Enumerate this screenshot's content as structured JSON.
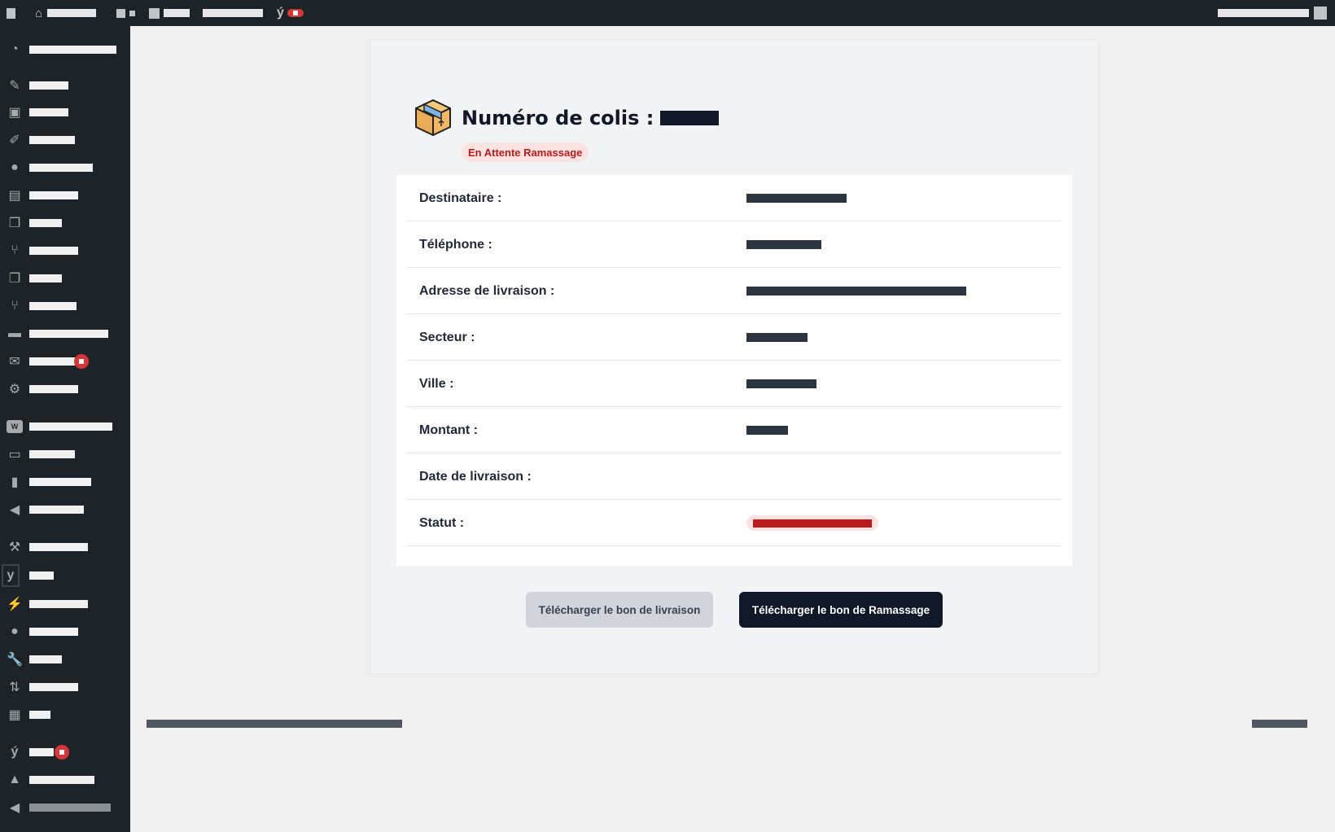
{
  "admin_bar": {
    "items": [
      "wp-logo-icon",
      "home-icon",
      "updates-icon",
      "comments-icon",
      "new-icon",
      "yoast-icon"
    ],
    "badge_color": "#d63638"
  },
  "sidebar": {
    "background": "#1d2327",
    "icons": [
      "dashboard-icon",
      "pin-icon",
      "media-icon",
      "brush-icon",
      "user-icon",
      "page-edit-icon",
      "pages-icon",
      "tree-icon",
      "pages-icon",
      "tree-icon",
      "comment-icon",
      "mail-icon",
      "settings-icon",
      "woo-icon",
      "archive-icon",
      "chart-icon",
      "megaphone-icon",
      "hammer-icon",
      "yoast-icon",
      "plugin-icon",
      "user-icon",
      "wrench-icon",
      "import-icon",
      "table-icon",
      "yoast-icon",
      "graduation-cap-icon",
      "collapse-icon"
    ]
  },
  "parcel": {
    "title": "Numéro de colis :",
    "status_badge": "En Attente Ramassage",
    "fields": [
      {
        "label": "Destinataire :"
      },
      {
        "label": "Téléphone :"
      },
      {
        "label": "Adresse de livraison :"
      },
      {
        "label": "Secteur :"
      },
      {
        "label": "Ville :"
      },
      {
        "label": "Montant :"
      },
      {
        "label": "Date de livraison :"
      },
      {
        "label": "Statut :"
      }
    ]
  },
  "actions": {
    "delivery_note_label": "Télécharger le bon de livraison",
    "pickup_note_label": "Télécharger le bon de Ramassage"
  },
  "colors": {
    "status_bg": "#fde2e2",
    "status_text": "#b91c1c",
    "primary_button": "#111827",
    "secondary_button": "#d1d5db"
  }
}
